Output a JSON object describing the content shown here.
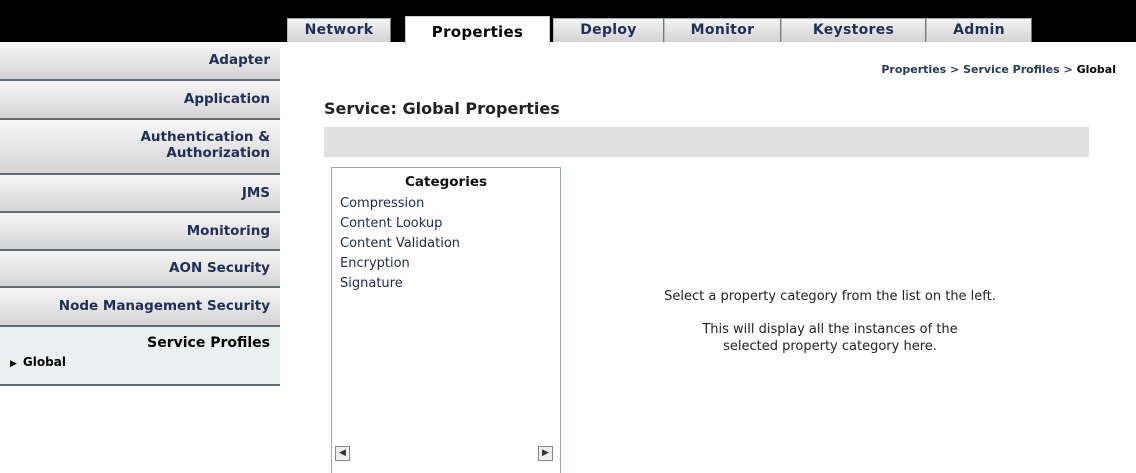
{
  "tabs": [
    {
      "label": "Network"
    },
    {
      "label": "Properties"
    },
    {
      "label": "Deploy"
    },
    {
      "label": "Monitor"
    },
    {
      "label": "Keystores"
    },
    {
      "label": "Admin"
    }
  ],
  "sidebar": {
    "items": [
      {
        "label": "Adapter"
      },
      {
        "label": "Application"
      },
      {
        "label": "Authentication & Authorization"
      },
      {
        "label": "JMS"
      },
      {
        "label": "Monitoring"
      },
      {
        "label": "AON Security"
      },
      {
        "label": "Node Management Security"
      },
      {
        "label": "Service Profiles",
        "sub_label": "Global"
      }
    ]
  },
  "breadcrumb": {
    "part1": "Properties",
    "sep": ">",
    "part2": "Service Profiles",
    "current": "Global"
  },
  "page": {
    "title": "Service: Global Properties"
  },
  "categories": {
    "title": "Categories",
    "items": [
      "Compression",
      "Content Lookup",
      "Content Validation",
      "Encryption",
      "Signature"
    ]
  },
  "message": {
    "line1": "Select a property category from the list on the left.",
    "line2": "This will display all the instances of the",
    "line3": "selected property category here."
  },
  "icons": {
    "scroll_left": "triangle-left",
    "scroll_right": "triangle-right",
    "sub_arrow": "triangle-right"
  }
}
